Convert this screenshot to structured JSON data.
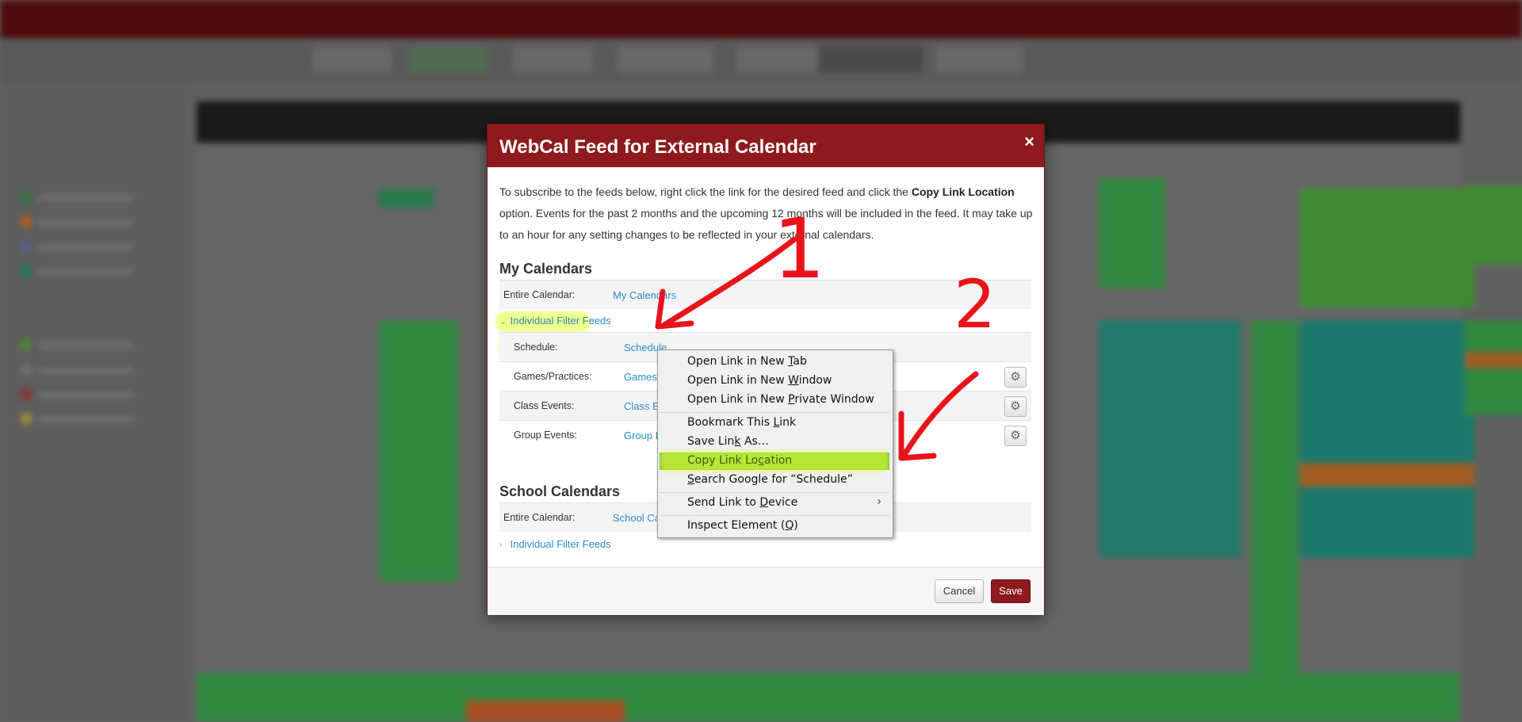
{
  "modal": {
    "title": "WebCal Feed for External Calendar",
    "close": "×",
    "intro_before": "To subscribe to the feeds below, right click the link for the desired feed and click the ",
    "intro_bold": "Copy Link Location",
    "intro_after": " option. Events for the past 2 months and the upcoming 12 months will be included in the feed. It may take up to an hour for any setting changes to be reflected in your external calendars.",
    "my_calendars": {
      "title": "My Calendars",
      "entire_label": "Entire Calendar:",
      "entire_link": "My Calendars",
      "filter_toggle": "Individual Filter Feeds",
      "feeds": [
        {
          "label": "Schedule:",
          "link": "Schedule"
        },
        {
          "label": "Games/Practices:",
          "link": "Games/Practices"
        },
        {
          "label": "Class Events:",
          "link": "Class Events"
        },
        {
          "label": "Group Events:",
          "link": "Group Events"
        }
      ]
    },
    "school_calendars": {
      "title": "School Calendars",
      "entire_label": "Entire Calendar:",
      "entire_link": "School Calendars",
      "filter_toggle": "Individual Filter Feeds"
    },
    "buttons": {
      "cancel": "Cancel",
      "save": "Save"
    }
  },
  "context_menu": {
    "items": [
      {
        "pre": "Open Link in New ",
        "u": "T",
        "post": "ab"
      },
      {
        "pre": "Open Link in New ",
        "u": "W",
        "post": "indow"
      },
      {
        "pre": "Open Link in New ",
        "u": "P",
        "post": "rivate Window"
      },
      {
        "pre": "Bookmark This ",
        "u": "L",
        "post": "ink"
      },
      {
        "pre": "Save Lin",
        "u": "k",
        "post": " As…"
      },
      {
        "pre": "Copy Link Lo",
        "u": "c",
        "post": "ation"
      },
      {
        "pre": "",
        "u": "S",
        "post": "earch Google for “Schedule”"
      },
      {
        "pre": "Send Link to ",
        "u": "D",
        "post": "evice"
      },
      {
        "pre": "Inspect Element (",
        "u": "Q",
        "post": ")"
      }
    ],
    "active_index": 5,
    "submenu_arrow": "›"
  },
  "annotations": {
    "step1": "1",
    "step2": "2",
    "color": "#e8141c"
  },
  "colors": {
    "brand": "#8e1a1e",
    "link": "#2a8ec9",
    "highlight": "#e4ff28",
    "menu_active": "#84c84a"
  }
}
